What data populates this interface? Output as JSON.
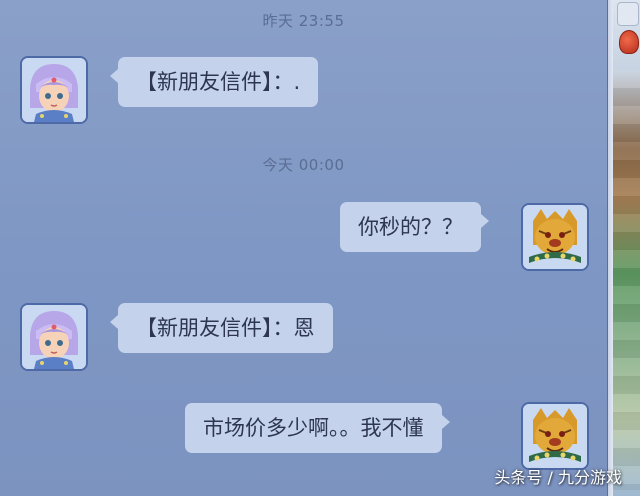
{
  "messages": [
    {
      "type": "timestamp",
      "text": "昨天  23:55"
    },
    {
      "type": "incoming",
      "sender": "girl-avatar",
      "text": "【新朋友信件】：."
    },
    {
      "type": "timestamp",
      "text": "今天  00:00"
    },
    {
      "type": "outgoing",
      "sender": "tiger-avatar",
      "text": "你秒的？？"
    },
    {
      "type": "incoming",
      "sender": "girl-avatar",
      "text": "【新朋友信件】：恩"
    },
    {
      "type": "outgoing",
      "sender": "tiger-avatar",
      "text": "市场价多少啊。。我不懂"
    }
  ],
  "watermark": "头条号 / 九分游戏",
  "colors": {
    "panel_background": "#8099c5",
    "bubble_background": "#c4d2ec",
    "bubble_text": "#2d3550",
    "timestamp_text": "#5a6d93"
  }
}
